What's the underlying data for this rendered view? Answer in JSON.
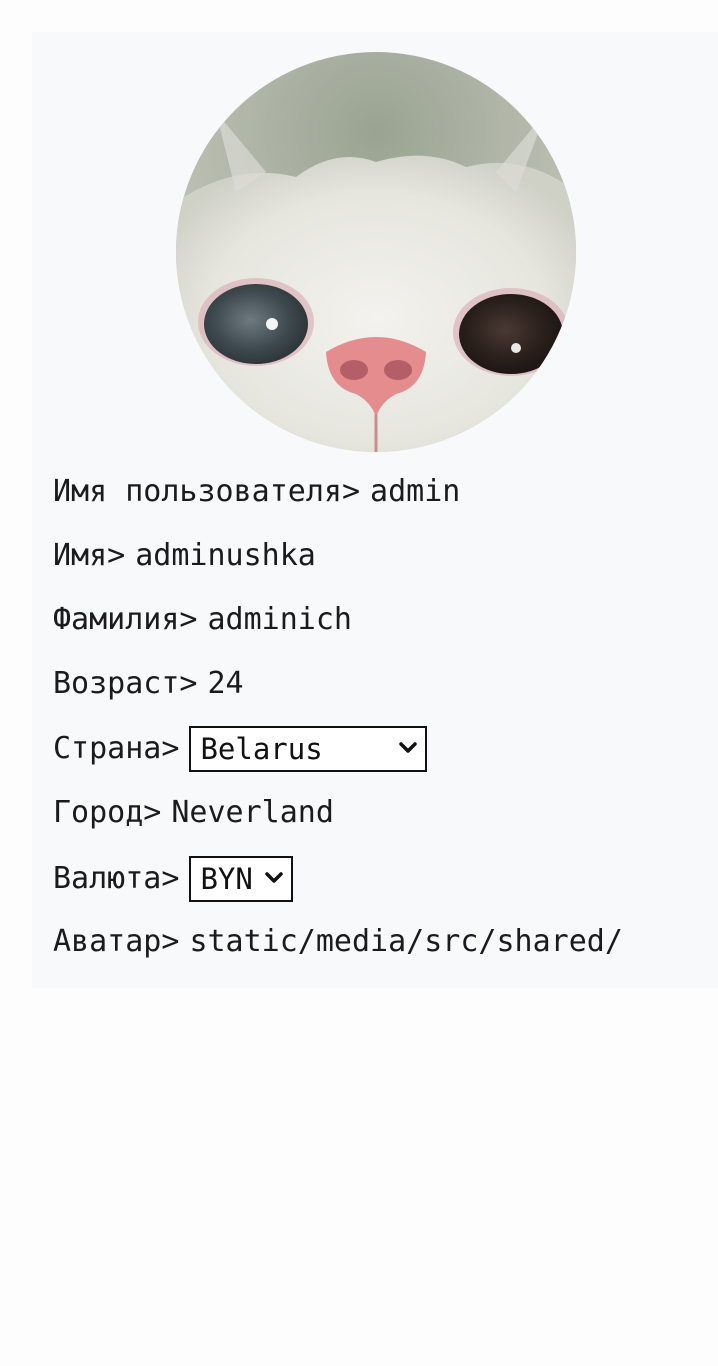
{
  "profile": {
    "avatar_name": "cat-avatar-icon",
    "username": {
      "label": "Имя пользователя>",
      "value": "admin"
    },
    "first_name": {
      "label": "Имя>",
      "value": "adminushka"
    },
    "last_name": {
      "label": "Фамилия>",
      "value": "adminich"
    },
    "age": {
      "label": "Возраст>",
      "value": "24"
    },
    "country": {
      "label": "Страна>",
      "selected": "Belarus"
    },
    "city": {
      "label": "Город>",
      "value": "Neverland"
    },
    "currency": {
      "label": "Валюта>",
      "selected": "BYN"
    },
    "avatar": {
      "label": "Аватар>",
      "value": "static/media/src/shared/"
    }
  },
  "colors": {
    "page_bg": "#fdfdfd",
    "card_bg": "#f8f9fb",
    "text": "#1b1b1b"
  }
}
